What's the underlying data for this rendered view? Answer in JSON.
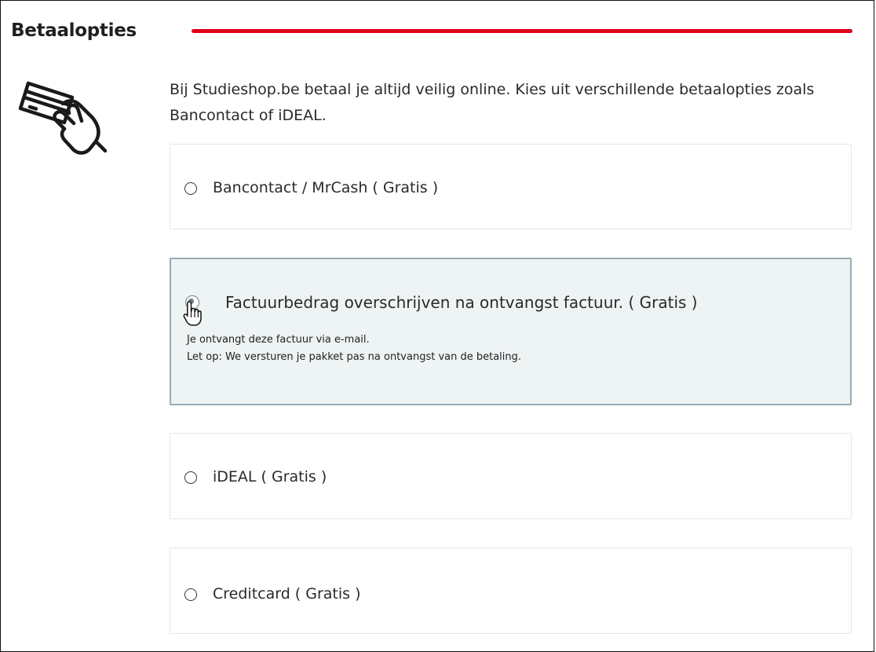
{
  "section": {
    "title": "Betaalopties",
    "accent_color": "#e2001a",
    "icon": "hand-card-icon"
  },
  "intro": {
    "text": "Bij Studieshop.be betaal je altijd veilig online. Kies uit verschillende betaalopties zoals Bancontact of iDEAL."
  },
  "options": [
    {
      "label": "Bancontact / MrCash ( Gratis )",
      "selected": false
    },
    {
      "label": "Factuurbedrag overschrijven na ontvangst factuur. ( Gratis )",
      "selected": true,
      "description": [
        "Je ontvangt deze factuur via e-mail.",
        "Let op: We versturen je pakket pas na ontvangst van de betaling."
      ]
    },
    {
      "label": "iDEAL ( Gratis )",
      "selected": false
    },
    {
      "label": "Creditcard ( Gratis )",
      "selected": false
    }
  ],
  "cursor": {
    "icon": "hand-pointer-icon"
  }
}
